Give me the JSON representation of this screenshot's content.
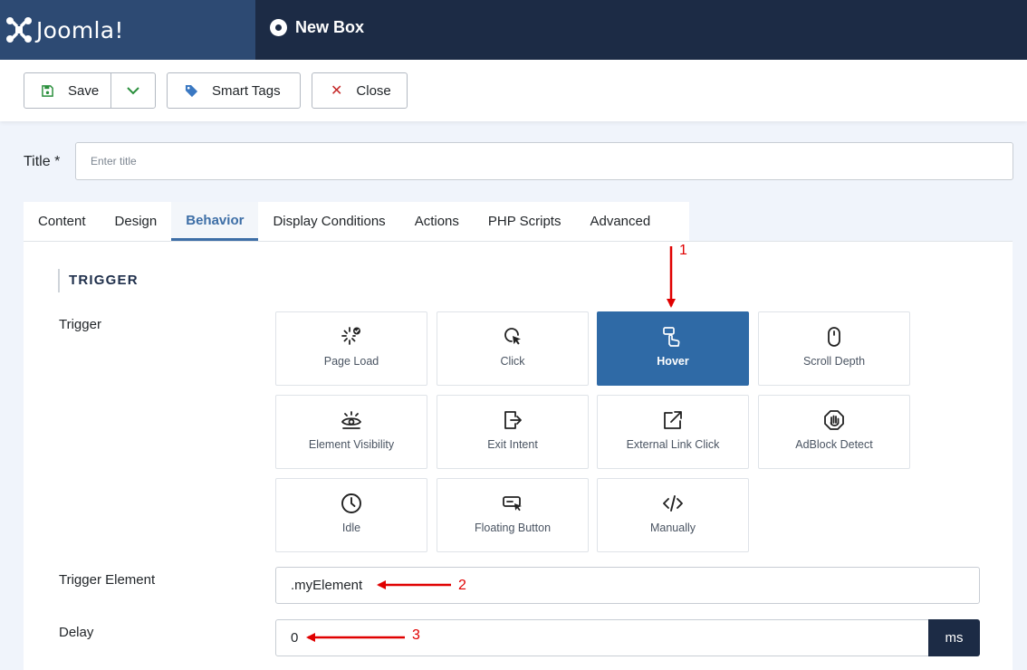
{
  "header": {
    "brand_name": "Joomla!",
    "page_title": "New Box"
  },
  "toolbar": {
    "save_label": "Save",
    "smart_tags_label": "Smart Tags",
    "close_label": "Close",
    "icons": {
      "save": "floppy-disk-icon",
      "dropdown": "chevron-down-icon",
      "smart_tags": "tag-icon",
      "close": "close-icon"
    }
  },
  "title_field": {
    "label": "Title *",
    "placeholder": "Enter title",
    "value": ""
  },
  "tabs": [
    {
      "label": "Content",
      "active": false
    },
    {
      "label": "Design",
      "active": false
    },
    {
      "label": "Behavior",
      "active": true
    },
    {
      "label": "Display Conditions",
      "active": false
    },
    {
      "label": "Actions",
      "active": false
    },
    {
      "label": "PHP Scripts",
      "active": false
    },
    {
      "label": "Advanced",
      "active": false
    }
  ],
  "behavior": {
    "section_heading": "TRIGGER",
    "trigger_label": "Trigger",
    "triggers": [
      {
        "label": "Page Load",
        "icon": "page-load-icon",
        "selected": false
      },
      {
        "label": "Click",
        "icon": "click-icon",
        "selected": false
      },
      {
        "label": "Hover",
        "icon": "hover-hand-icon",
        "selected": true
      },
      {
        "label": "Scroll Depth",
        "icon": "mouse-icon",
        "selected": false
      },
      {
        "label": "Element Visibility",
        "icon": "eye-icon",
        "selected": false
      },
      {
        "label": "Exit Intent",
        "icon": "exit-icon",
        "selected": false
      },
      {
        "label": "External Link Click",
        "icon": "external-link-icon",
        "selected": false
      },
      {
        "label": "AdBlock Detect",
        "icon": "hand-stop-icon",
        "selected": false
      },
      {
        "label": "Idle",
        "icon": "clock-icon",
        "selected": false
      },
      {
        "label": "Floating Button",
        "icon": "floating-button-icon",
        "selected": false
      },
      {
        "label": "Manually",
        "icon": "code-icon",
        "selected": false
      }
    ],
    "trigger_element_label": "Trigger Element",
    "trigger_element_value": ".myElement",
    "delay_label": "Delay",
    "delay_value": "0",
    "delay_unit": "ms"
  },
  "annotations": [
    {
      "number": "1",
      "color": "#e00000"
    },
    {
      "number": "2",
      "color": "#e00000"
    },
    {
      "number": "3",
      "color": "#e00000"
    }
  ]
}
